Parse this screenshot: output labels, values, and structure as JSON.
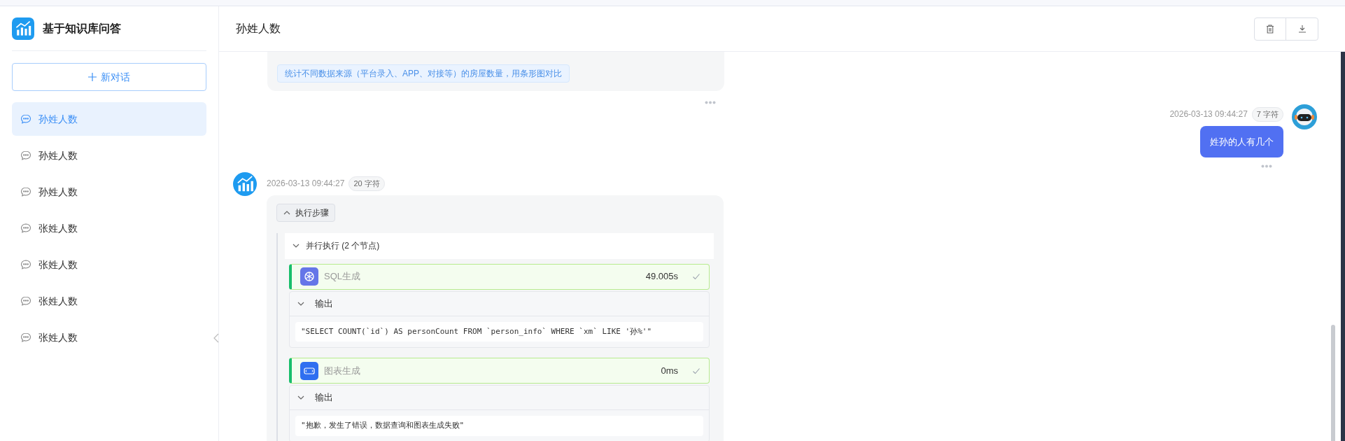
{
  "app": {
    "title": "基于知识库问答"
  },
  "new_chat_button": "新对话",
  "conversations": [
    {
      "title": "孙姓人数",
      "selected": true
    },
    {
      "title": "孙姓人数",
      "selected": false
    },
    {
      "title": "孙姓人数",
      "selected": false
    },
    {
      "title": "张姓人数",
      "selected": false
    },
    {
      "title": "张姓人数",
      "selected": false
    },
    {
      "title": "张姓人数",
      "selected": false
    },
    {
      "title": "张姓人数",
      "selected": false
    }
  ],
  "header": {
    "title": "孙姓人数"
  },
  "suggestions": [
    "统计不同数据来源（平台录入、APP、对接等）的房屋数量，用条形图对比"
  ],
  "user_message": {
    "time": "2026-03-13 09:44:27",
    "count": "7 字符",
    "text": "姓孙的人有几个"
  },
  "bot_message": {
    "time": "2026-03-13 09:44:27",
    "count": "20 字符",
    "steps_toggle": "执行步骤",
    "expanded": true,
    "group": {
      "title": "并行执行 (2 个节点)",
      "expanded": true,
      "nodes": [
        {
          "kind": "sql",
          "name": "SQL生成",
          "duration": "49.005s",
          "done": true,
          "output_label": "输出",
          "output": "\"SELECT COUNT(`id`) AS personCount FROM `person_info` WHERE `xm` LIKE '孙%'\""
        },
        {
          "kind": "code",
          "name": "图表生成",
          "duration": "0ms",
          "done": true,
          "output_label": "输出",
          "output": "\"抱歉，发生了错误，数据查询和图表生成失败\""
        }
      ]
    }
  }
}
